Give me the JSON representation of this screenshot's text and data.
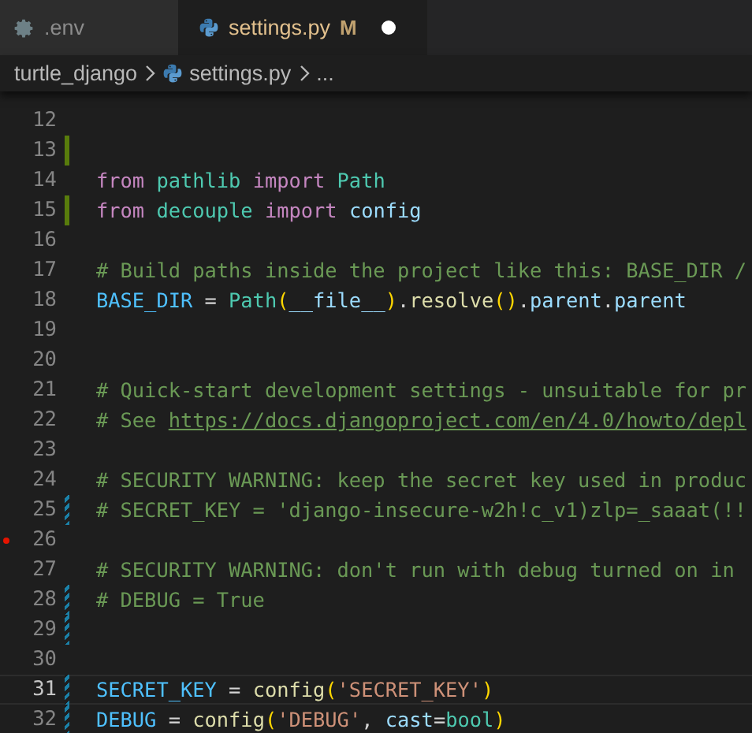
{
  "tabs": [
    {
      "label": ".env",
      "selected": false,
      "modified": false,
      "dirty": false
    },
    {
      "label": "settings.py",
      "selected": true,
      "modified": true,
      "badge": "M",
      "dirty": true
    }
  ],
  "breadcrumb": [
    {
      "label": "turtle_django"
    },
    {
      "label": "settings.py"
    },
    {
      "label": "..."
    }
  ],
  "lines": [
    {
      "number": "12",
      "added": false,
      "modified": false,
      "deleted": false,
      "current": false
    },
    {
      "number": "13",
      "added": true,
      "modified": false,
      "deleted": false,
      "current": false
    },
    {
      "number": "14",
      "added": false,
      "modified": false,
      "deleted": false,
      "current": false,
      "tokens": [
        {
          "kind": "kw",
          "text": "from "
        },
        {
          "kind": "cls",
          "text": "pathlib "
        },
        {
          "kind": "kw",
          "text": "import "
        },
        {
          "kind": "cls",
          "text": "Path"
        }
      ]
    },
    {
      "number": "15",
      "added": true,
      "modified": false,
      "deleted": false,
      "current": false,
      "tokens": [
        {
          "kind": "kw",
          "text": "from "
        },
        {
          "kind": "cls",
          "text": "decouple "
        },
        {
          "kind": "kw",
          "text": "import "
        },
        {
          "kind": "var",
          "text": "config"
        }
      ]
    },
    {
      "number": "16",
      "added": false,
      "modified": false,
      "deleted": false,
      "current": false
    },
    {
      "number": "17",
      "added": false,
      "modified": false,
      "deleted": false,
      "current": false,
      "tokens": [
        {
          "kind": "cmt",
          "text": "# Build paths inside the project like this: BASE_DIR /"
        }
      ]
    },
    {
      "number": "18",
      "added": false,
      "modified": false,
      "deleted": false,
      "current": false,
      "tokens": [
        {
          "kind": "const",
          "text": "BASE_DIR "
        },
        {
          "kind": "plain",
          "text": "= "
        },
        {
          "kind": "cls",
          "text": "Path"
        },
        {
          "kind": "brk",
          "text": "("
        },
        {
          "kind": "var",
          "text": "__file__"
        },
        {
          "kind": "brk",
          "text": ")"
        },
        {
          "kind": "plain",
          "text": "."
        },
        {
          "kind": "fn",
          "text": "resolve"
        },
        {
          "kind": "brk",
          "text": "()"
        },
        {
          "kind": "plain",
          "text": "."
        },
        {
          "kind": "var",
          "text": "parent"
        },
        {
          "kind": "plain",
          "text": "."
        },
        {
          "kind": "var",
          "text": "parent"
        }
      ]
    },
    {
      "number": "19",
      "added": false,
      "modified": false,
      "deleted": false,
      "current": false
    },
    {
      "number": "20",
      "added": false,
      "modified": false,
      "deleted": false,
      "current": false
    },
    {
      "number": "21",
      "added": false,
      "modified": false,
      "deleted": false,
      "current": false,
      "tokens": [
        {
          "kind": "cmt",
          "text": "# Quick-start development settings - unsuitable for pr"
        }
      ]
    },
    {
      "number": "22",
      "added": false,
      "modified": false,
      "deleted": false,
      "current": false,
      "tokens": [
        {
          "kind": "cmt",
          "text": "# See "
        },
        {
          "kind": "link",
          "text": "https://docs.djangoproject.com/en/4.0/howto/depl"
        }
      ]
    },
    {
      "number": "23",
      "added": false,
      "modified": false,
      "deleted": false,
      "current": false
    },
    {
      "number": "24",
      "added": false,
      "modified": false,
      "deleted": false,
      "current": false,
      "tokens": [
        {
          "kind": "cmt",
          "text": "# SECURITY WARNING: keep the secret key used in produc"
        }
      ]
    },
    {
      "number": "25",
      "added": false,
      "modified": true,
      "deleted": false,
      "current": false,
      "tokens": [
        {
          "kind": "cmt",
          "text": "# SECRET_KEY = 'django-insecure-w2h!c_v1)zlp=_saaat(!!"
        }
      ]
    },
    {
      "number": "26",
      "added": false,
      "modified": false,
      "deleted": true,
      "current": false
    },
    {
      "number": "27",
      "added": false,
      "modified": false,
      "deleted": false,
      "current": false,
      "tokens": [
        {
          "kind": "cmt",
          "text": "# SECURITY WARNING: don't run with debug turned on in"
        }
      ]
    },
    {
      "number": "28",
      "added": false,
      "modified": true,
      "deleted": false,
      "current": false,
      "tokens": [
        {
          "kind": "cmt",
          "text": "# DEBUG = True"
        }
      ]
    },
    {
      "number": "29",
      "added": false,
      "modified": true,
      "deleted": false,
      "current": false
    },
    {
      "number": "30",
      "added": false,
      "modified": false,
      "deleted": false,
      "current": false
    },
    {
      "number": "31",
      "added": false,
      "modified": true,
      "deleted": false,
      "current": true,
      "tokens": [
        {
          "kind": "const",
          "text": "SECRET_KEY "
        },
        {
          "kind": "plain",
          "text": "= "
        },
        {
          "kind": "fn",
          "text": "config"
        },
        {
          "kind": "brk",
          "text": "("
        },
        {
          "kind": "str",
          "text": "'SECRET_KEY'"
        },
        {
          "kind": "brk",
          "text": ")"
        }
      ]
    },
    {
      "number": "32",
      "added": false,
      "modified": true,
      "deleted": false,
      "current": false,
      "tokens": [
        {
          "kind": "const",
          "text": "DEBUG "
        },
        {
          "kind": "plain",
          "text": "= "
        },
        {
          "kind": "fn",
          "text": "config"
        },
        {
          "kind": "brk",
          "text": "("
        },
        {
          "kind": "str",
          "text": "'DEBUG'"
        },
        {
          "kind": "plain",
          "text": ", "
        },
        {
          "kind": "var",
          "text": "cast"
        },
        {
          "kind": "plain",
          "text": "="
        },
        {
          "kind": "cls",
          "text": "bool"
        },
        {
          "kind": "brk",
          "text": ")"
        }
      ]
    }
  ]
}
